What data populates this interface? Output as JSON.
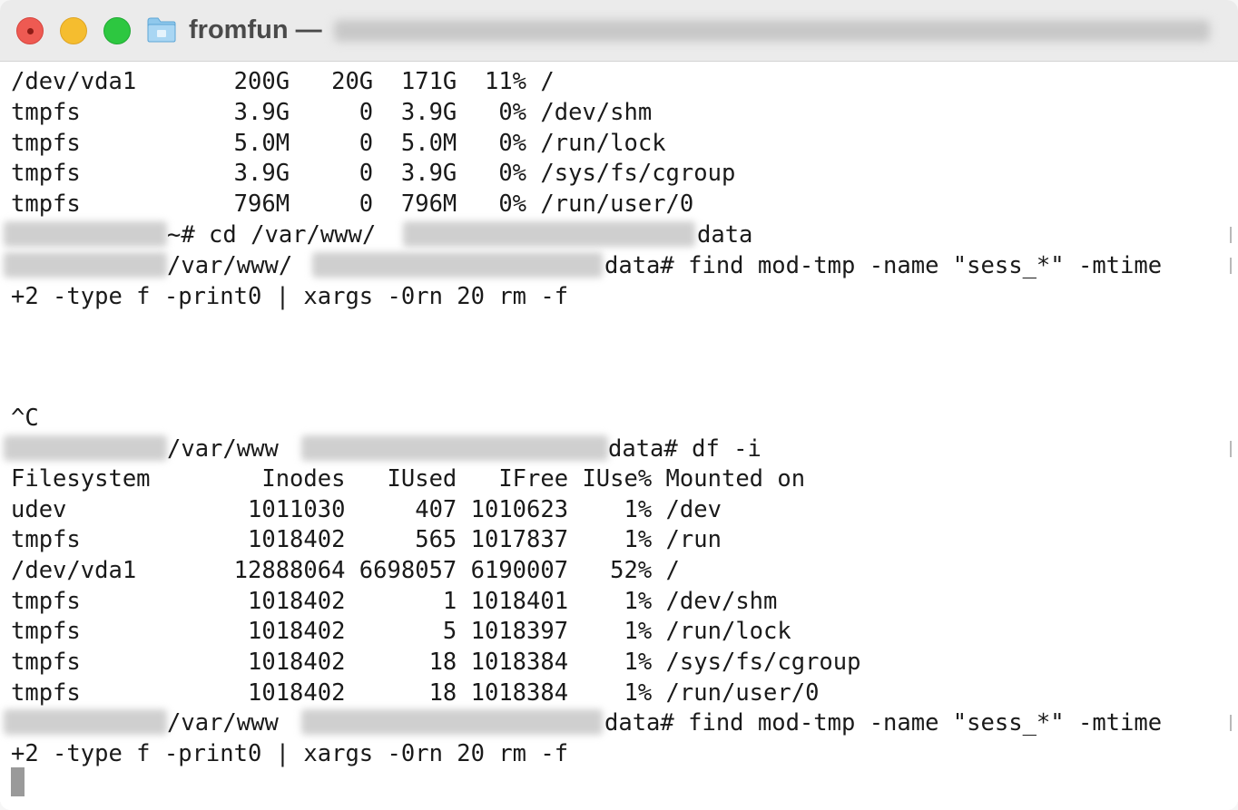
{
  "window": {
    "title": "fromfun —"
  },
  "terminal": {
    "lines": [
      "/dev/vda1       200G   20G  171G  11% /",
      "tmpfs           3.9G     0  3.9G   0% /dev/shm",
      "tmpfs           5.0M     0  5.0M   0% /run/lock",
      "tmpfs           3.9G     0  3.9G   0% /sys/fs/cgroup",
      "tmpfs           796M     0  796M   0% /run/user/0",
      "~# cd /var/www/",
      "data",
      "/var/www/",
      "data# find mod-tmp -name \"sess_*\" -mtime",
      "+2 -type f -print0 | xargs -0rn 20 rm -f",
      "^C",
      "/var/www",
      "data# df -i",
      "Filesystem        Inodes   IUsed   IFree IUse% Mounted on",
      "udev             1011030     407 1010623    1% /dev",
      "tmpfs            1018402     565 1017837    1% /run",
      "/dev/vda1       12888064 6698057 6190007   52% /",
      "tmpfs            1018402       1 1018401    1% /dev/shm",
      "tmpfs            1018402       5 1018397    1% /run/lock",
      "tmpfs            1018402      18 1018384    1% /sys/fs/cgroup",
      "tmpfs            1018402      18 1018384    1% /run/user/0",
      "/var/www",
      "data# find mod-tmp -name \"sess_*\" -mtime",
      "+2 -type f -print0 | xargs -0rn 20 rm -f"
    ]
  },
  "icons": {
    "folder": "folder-icon",
    "close": "close-icon",
    "minimize": "minimize-icon",
    "maximize": "maximize-icon"
  },
  "colors": {
    "close": "#ee5a52",
    "minimize": "#f5bd2f",
    "maximize": "#2dc740",
    "folder": "#7fbfe6"
  }
}
